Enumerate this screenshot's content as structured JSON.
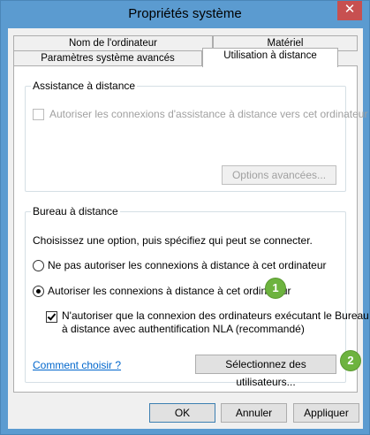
{
  "window": {
    "title": "Propriétés système",
    "close_glyph": "✕"
  },
  "tabs": {
    "computer_name": "Nom de l'ordinateur",
    "hardware": "Matériel",
    "advanced": "Paramètres système avancés",
    "remote": "Utilisation à distance"
  },
  "assistance": {
    "group_label": "Assistance à distance",
    "allow_label": "Autoriser les connexions d'assistance à distance vers cet ordinateur",
    "allow_checked": false,
    "advanced_button": "Options avancées..."
  },
  "remote_desktop": {
    "group_label": "Bureau à distance",
    "instruction": "Choisissez une option, puis spécifiez qui peut se connecter.",
    "option_deny": "Ne pas autoriser les connexions à distance à cet ordinateur",
    "option_allow": "Autoriser les connexions à distance à cet ordinateur",
    "selected_option": "allow",
    "nla_line1": "N'autoriser que la connexion des ordinateurs exécutant le Bureau",
    "nla_line2": "à distance avec authentification NLA (recommandé)",
    "nla_checked": true,
    "help_link": "Comment choisir ?",
    "select_users_button": "Sélectionnez des utilisateurs..."
  },
  "annotations": {
    "step1": "1",
    "step2": "2",
    "color": "#6db33f"
  },
  "footer": {
    "ok": "OK",
    "cancel": "Annuler",
    "apply": "Appliquer"
  }
}
